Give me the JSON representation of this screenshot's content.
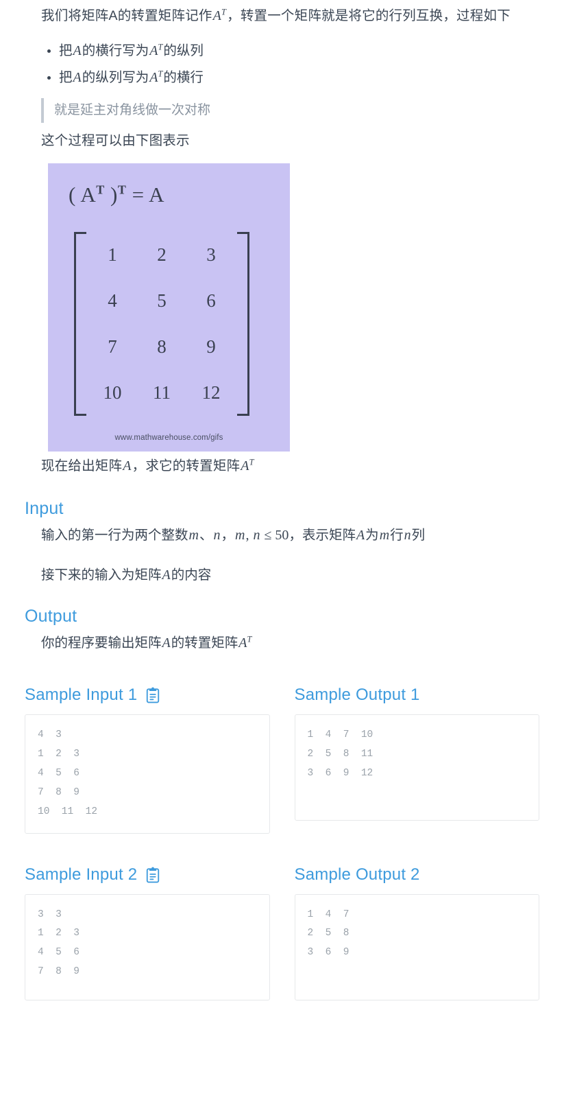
{
  "description": {
    "intro_a": "我们将矩阵A的转置矩阵记作",
    "intro_math1": "A",
    "intro_math1_sup": "T",
    "intro_b": "，转置一个矩阵就是将它的行列互换，过程如下",
    "bullets": [
      {
        "pre": "把",
        "v1": "A",
        "mid": "的横行写为",
        "v2": "A",
        "sup": "T",
        "post": "的纵列"
      },
      {
        "pre": "把",
        "v1": "A",
        "mid": "的纵列写为",
        "v2": "A",
        "sup": "T",
        "post": "的横行"
      }
    ],
    "quote": "就是延主对角线做一次对称",
    "figure_lead": "这个过程可以由下图表示",
    "after_figure_pre": "现在给出矩阵",
    "after_figure_v1": "A",
    "after_figure_mid": "，求它的转置矩阵",
    "after_figure_v2": "A",
    "after_figure_sup": "T"
  },
  "figure": {
    "title_open": "( A",
    "title_sup1": "T",
    "title_close": " )",
    "title_sup2": "T",
    "title_eq": " = A",
    "matrix": [
      [
        "1",
        "2",
        "3"
      ],
      [
        "4",
        "5",
        "6"
      ],
      [
        "7",
        "8",
        "9"
      ],
      [
        "10",
        "11",
        "12"
      ]
    ],
    "credit": "www.mathwarehouse.com/gifs",
    "background_color": "#c9c3f3"
  },
  "input_section": {
    "heading": "Input",
    "line1_a": "输入的第一行为两个整数",
    "line1_m": "m",
    "line1_b": "、",
    "line1_n": "n",
    "line1_c": "，",
    "line1_m2": "m",
    "line1_comma": ", ",
    "line1_n2": "n",
    "line1_le": " ≤ 50",
    "line1_d": "，表示矩阵",
    "line1_A": "A",
    "line1_e": "为",
    "line1_m3": "m",
    "line1_f": "行",
    "line1_n3": "n",
    "line1_g": "列",
    "line2_a": "接下来的输入为矩阵",
    "line2_A": "A",
    "line2_b": "的内容"
  },
  "output_section": {
    "heading": "Output",
    "line1_a": "你的程序要输出矩阵",
    "line1_A": "A",
    "line1_b": "的转置矩阵",
    "line1_A2": "A",
    "line1_sup": "T"
  },
  "samples": [
    {
      "input_label": "Sample Input 1",
      "input_icon": "clipboard-copy-icon",
      "input_code": "4  3\n1  2  3\n4  5  6\n7  8  9\n10  11  12",
      "output_label": "Sample Output 1",
      "output_code": "1  4  7  10\n2  5  8  11\n3  6  9  12"
    },
    {
      "input_label": "Sample Input 2",
      "input_icon": "clipboard-copy-icon",
      "input_code": "3  3\n1  2  3\n4  5  6\n7  8  9",
      "output_label": "Sample Output 2",
      "output_code": "1  4  7\n2  5  8\n3  6  9"
    }
  ],
  "theme": {
    "heading_blue": "#3e9bdd",
    "body_text": "#3b4654",
    "code_text": "#9aa2aa",
    "code_border": "#e6e8ea",
    "quote_bar": "#c3cad3"
  }
}
